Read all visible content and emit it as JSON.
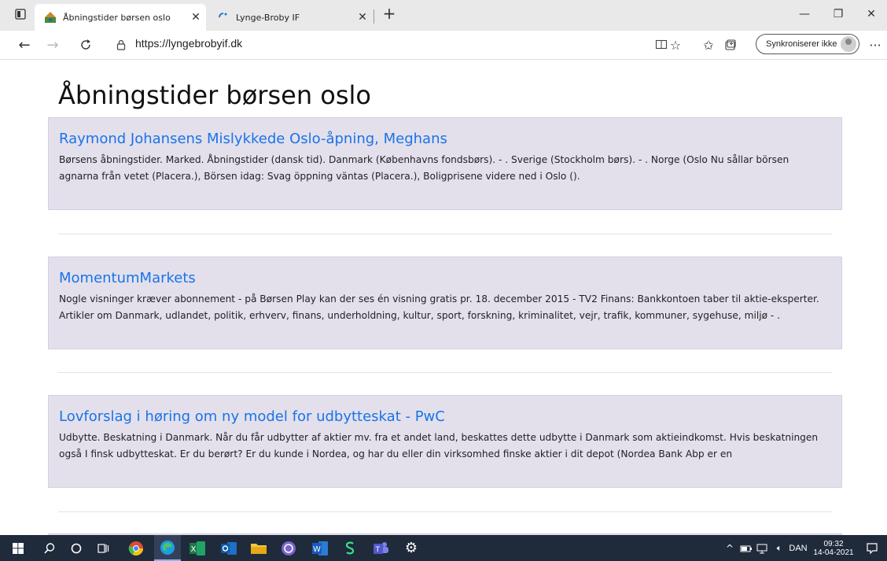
{
  "browser": {
    "tabs": [
      {
        "title": "Åbningstider børsen oslo",
        "active": true
      },
      {
        "title": "Lynge-Broby IF",
        "active": false
      }
    ],
    "url": "https://lyngebrobyif.dk",
    "sync_label": "Synkroniserer ikke"
  },
  "page": {
    "title": "Åbningstider børsen oslo",
    "results": [
      {
        "title": "Raymond Johansens Mislykkede Oslo-åpning, Meghans",
        "text": "Børsens åbningstider. Marked. Åbningstider (dansk tid). Danmark (Københavns fondsbørs). - . Sverige (Stockholm børs). - . Norge (Oslo  Nu sållar börsen agnarna från vetet (Placera.), Börsen idag: Svag öppning väntas (Placera.), Boligprisene videre ned i Oslo ()."
      },
      {
        "title": "MomentumMarkets",
        "text": "Nogle visninger kræver abonnement - på Børsen Play kan der ses én visning gratis pr. 18. december 2015 - TV2 Finans: Bankkontoen taber til aktie-eksperter. Artikler om Danmark, udlandet, politik, erhverv, finans, underholdning, kultur, sport, forskning, kriminalitet, vejr, trafik, kommuner, sygehuse, miljø - ."
      },
      {
        "title": "Lovforslag i høring om ny model for udbytteskat - PwC",
        "text": "Udbytte. Beskatning i Danmark. Når du får udbytter af aktier mv. fra et andet land, beskattes dette udbytte i Danmark som aktieindkomst. Hvis beskatningen også  I finsk udbytteskat. Er du berørt? Er du kunde i Nordea, og har du eller din virksomhed finske aktier i dit depot (Nordea Bank Abp er en"
      }
    ]
  },
  "taskbar": {
    "language": "DAN",
    "time": "09:32",
    "date": "14-04-2021"
  },
  "colors": {
    "link": "#1a73e8",
    "card_bg": "#e3e0ec",
    "taskbar_bg": "#1f2a3b"
  }
}
